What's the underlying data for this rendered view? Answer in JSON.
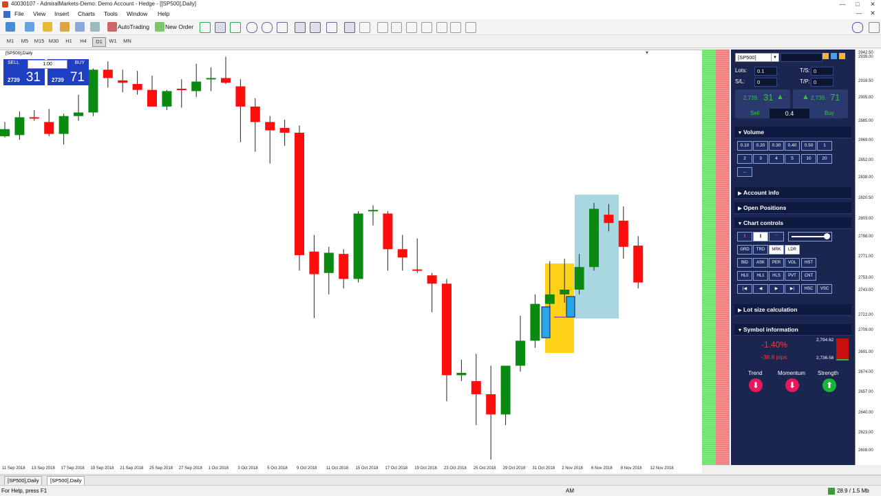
{
  "window": {
    "title": "40030107 - AdmiralMarkets-Demo: Demo Account - Hedge - [[SP500],Daily]"
  },
  "menu": [
    "File",
    "View",
    "Insert",
    "Charts",
    "Tools",
    "Window",
    "Help"
  ],
  "toolbar": {
    "autotrading": "AutoTrading",
    "new_order": "New Order"
  },
  "timeframes": [
    "M1",
    "M5",
    "M15",
    "M30",
    "H1",
    "H4",
    "D1",
    "W1",
    "MN"
  ],
  "active_timeframe": "D1",
  "chart": {
    "label": "[SP500],Daily"
  },
  "oneclick": {
    "sell_label": "SELL",
    "buy_label": "BUY",
    "lot": "1.00",
    "sell_small": "2739",
    "sell_big": "31",
    "buy_small": "2739",
    "buy_big": "71"
  },
  "price_ticks": [
    "2942.50",
    "2939.00",
    "2918.50",
    "2905.00",
    "2885.00",
    "2869.00",
    "2852.00",
    "2838.00",
    "2820.50",
    "2803.00",
    "2788.00",
    "2771.00",
    "2753.00",
    "2743.00",
    "2722.00",
    "2709.00",
    "2691.00",
    "2674.00",
    "2657.00",
    "2640.00",
    "2623.00",
    "2608.00"
  ],
  "date_ticks": [
    "11 Sep 2018",
    "13 Sep 2018",
    "17 Sep 2018",
    "19 Sep 2018",
    "21 Sep 2018",
    "25 Sep 2018",
    "27 Sep 2018",
    "1 Oct 2018",
    "3 Oct 2018",
    "5 Oct 2018",
    "9 Oct 2018",
    "11 Oct 2018",
    "15 Oct 2018",
    "17 Oct 2018",
    "19 Oct 2018",
    "23 Oct 2018",
    "25 Oct 2018",
    "29 Oct 2018",
    "31 Oct 2018",
    "2 Nov 2018",
    "6 Nov 2018",
    "8 Nov 2018",
    "12 Nov 2018"
  ],
  "panel": {
    "symbol": "[SP500]",
    "lots_label": "Lots:",
    "lots": "0.1",
    "ts_label": "T/S:",
    "ts": "0",
    "sl_label": "S/L:",
    "sl": "0",
    "tp_label": "T/P:",
    "tp": "0",
    "sell_price_small": "2,739.",
    "sell_price_big": "31",
    "buy_price_small": "2,739.",
    "buy_price_big": "71",
    "sell_label": "Sell",
    "buy_label": "Buy",
    "spread": "0.4",
    "sections": {
      "volume": "Volume",
      "account": "Account info",
      "positions": "Open Positions",
      "controls": "Chart controls",
      "lotcalc": "Lot size calculation",
      "symbol": "Symbol information"
    },
    "volume_buttons": [
      "0.10",
      "0.20",
      "0.30",
      "0.40",
      "0.50",
      "1",
      "2",
      "3",
      "4",
      "5",
      "10",
      "20",
      "..."
    ],
    "control_buttons_row1": [
      "GRD",
      "TRD",
      "MRK",
      "LDR"
    ],
    "control_buttons_row2": [
      "BID",
      "ASK",
      "PER",
      "VOL",
      "HST"
    ],
    "control_buttons_row3": [
      "HL0",
      "HL1",
      "HLS",
      "PVT",
      "CNT"
    ],
    "control_buttons_row4": [
      "|◀",
      "◀",
      "▶",
      "▶|",
      "HSC",
      "VSC"
    ],
    "symbol_info": {
      "change_pct": "-1.40%",
      "change_pips": "-38.8 pips",
      "high": "2,794.62",
      "low": "2,736.58",
      "trend_label": "Trend",
      "momentum_label": "Momentum",
      "strength_label": "Strength"
    }
  },
  "tabs": [
    "[SP500],Daily",
    "[SP500],Daily"
  ],
  "status": {
    "help": "For Help, press F1",
    "mode": "AM",
    "traffic": "28.9 / 1.5 Mb"
  },
  "candles": [
    {
      "o": 2879,
      "h": 2885,
      "l": 2872,
      "c": 2873,
      "d": "up"
    },
    {
      "o": 2874,
      "h": 2894,
      "l": 2870,
      "c": 2889,
      "d": "up"
    },
    {
      "o": 2889,
      "h": 2895,
      "l": 2886,
      "c": 2888,
      "d": "dn"
    },
    {
      "o": 2885,
      "h": 2896,
      "l": 2873,
      "c": 2875,
      "d": "dn"
    },
    {
      "o": 2875,
      "h": 2892,
      "l": 2866,
      "c": 2890,
      "d": "up"
    },
    {
      "o": 2890,
      "h": 2908,
      "l": 2886,
      "c": 2893,
      "d": "up"
    },
    {
      "o": 2893,
      "h": 2930,
      "l": 2890,
      "c": 2929,
      "d": "up"
    },
    {
      "o": 2929,
      "h": 2936,
      "l": 2914,
      "c": 2922,
      "d": "dn"
    },
    {
      "o": 2920,
      "h": 2929,
      "l": 2910,
      "c": 2918,
      "d": "dn"
    },
    {
      "o": 2917,
      "h": 2928,
      "l": 2908,
      "c": 2912,
      "d": "dn"
    },
    {
      "o": 2912,
      "h": 2924,
      "l": 2898,
      "c": 2898,
      "d": "dn"
    },
    {
      "o": 2898,
      "h": 2912,
      "l": 2895,
      "c": 2911,
      "d": "up"
    },
    {
      "o": 2912,
      "h": 2921,
      "l": 2897,
      "c": 2913,
      "d": "dn"
    },
    {
      "o": 2911,
      "h": 2934,
      "l": 2906,
      "c": 2919,
      "d": "up"
    },
    {
      "o": 2921,
      "h": 2931,
      "l": 2911,
      "c": 2922,
      "d": "up"
    },
    {
      "o": 2922,
      "h": 2940,
      "l": 2917,
      "c": 2918,
      "d": "dn"
    },
    {
      "o": 2915,
      "h": 2921,
      "l": 2868,
      "c": 2898,
      "d": "dn"
    },
    {
      "o": 2898,
      "h": 2905,
      "l": 2860,
      "c": 2885,
      "d": "dn"
    },
    {
      "o": 2885,
      "h": 2890,
      "l": 2850,
      "c": 2878,
      "d": "dn"
    },
    {
      "o": 2880,
      "h": 2887,
      "l": 2865,
      "c": 2876,
      "d": "dn"
    },
    {
      "o": 2876,
      "h": 2882,
      "l": 2760,
      "c": 2773,
      "d": "dn"
    },
    {
      "o": 2776,
      "h": 2790,
      "l": 2720,
      "c": 2757,
      "d": "dn"
    },
    {
      "o": 2758,
      "h": 2780,
      "l": 2740,
      "c": 2775,
      "d": "up"
    },
    {
      "o": 2774,
      "h": 2778,
      "l": 2745,
      "c": 2753,
      "d": "dn"
    },
    {
      "o": 2753,
      "h": 2810,
      "l": 2750,
      "c": 2808,
      "d": "up"
    },
    {
      "o": 2810,
      "h": 2815,
      "l": 2798,
      "c": 2811,
      "d": "up"
    },
    {
      "o": 2808,
      "h": 2810,
      "l": 2760,
      "c": 2778,
      "d": "dn"
    },
    {
      "o": 2778,
      "h": 2790,
      "l": 2760,
      "c": 2771,
      "d": "dn"
    },
    {
      "o": 2761,
      "h": 2787,
      "l": 2758,
      "c": 2760,
      "d": "dn"
    },
    {
      "o": 2756,
      "h": 2758,
      "l": 2725,
      "c": 2749,
      "d": "dn"
    },
    {
      "o": 2749,
      "h": 2753,
      "l": 2650,
      "c": 2672,
      "d": "dn"
    },
    {
      "o": 2672,
      "h": 2685,
      "l": 2667,
      "c": 2674,
      "d": "up"
    },
    {
      "o": 2667,
      "h": 2690,
      "l": 2630,
      "c": 2656,
      "d": "dn"
    },
    {
      "o": 2656,
      "h": 2680,
      "l": 2601,
      "c": 2639,
      "d": "dn"
    },
    {
      "o": 2639,
      "h": 2662,
      "l": 2630,
      "c": 2680,
      "d": "up"
    },
    {
      "o": 2680,
      "h": 2722,
      "l": 2675,
      "c": 2701,
      "d": "up"
    },
    {
      "o": 2701,
      "h": 2740,
      "l": 2695,
      "c": 2732,
      "d": "up"
    },
    {
      "o": 2732,
      "h": 2768,
      "l": 2712,
      "c": 2740,
      "d": "up"
    },
    {
      "o": 2740,
      "h": 2770,
      "l": 2733,
      "c": 2744,
      "d": "up"
    },
    {
      "o": 2744,
      "h": 2774,
      "l": 2740,
      "c": 2763,
      "d": "up"
    },
    {
      "o": 2763,
      "h": 2817,
      "l": 2760,
      "c": 2812,
      "d": "up"
    },
    {
      "o": 2807,
      "h": 2816,
      "l": 2793,
      "c": 2800,
      "d": "dn"
    },
    {
      "o": 2802,
      "h": 2814,
      "l": 2770,
      "c": 2780,
      "d": "dn"
    },
    {
      "o": 2781,
      "h": 2789,
      "l": 2745,
      "c": 2750,
      "d": "dn"
    }
  ]
}
